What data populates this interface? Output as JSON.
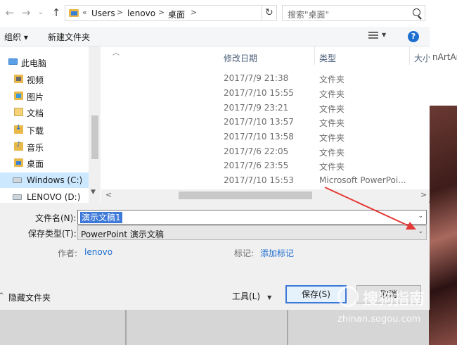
{
  "address": {
    "path_prefix": "«",
    "crumbs": [
      "Users",
      "lenovo",
      "桌面"
    ],
    "search_placeholder": "搜索\"桌面\""
  },
  "toolbar": {
    "organize": "组织 ▾",
    "new_folder": "新建文件夹"
  },
  "nav": {
    "items": [
      {
        "label": "此电脑",
        "icon": "pc-icon"
      },
      {
        "label": "视频",
        "icon": "video-folder-icon"
      },
      {
        "label": "图片",
        "icon": "picture-folder-icon"
      },
      {
        "label": "文档",
        "icon": "document-folder-icon"
      },
      {
        "label": "下载",
        "icon": "download-folder-icon"
      },
      {
        "label": "音乐",
        "icon": "music-folder-icon"
      },
      {
        "label": "桌面",
        "icon": "desktop-folder-icon"
      },
      {
        "label": "Windows (C:)",
        "icon": "drive-icon"
      },
      {
        "label": "LENOVO (D:)",
        "icon": "drive-icon"
      }
    ]
  },
  "files": {
    "columns": {
      "date": "修改日期",
      "type": "类型",
      "size": "大小"
    },
    "rows": [
      {
        "date": "2017/7/9 21:38",
        "type": "文件夹"
      },
      {
        "date": "2017/7/10 15:55",
        "type": "文件夹"
      },
      {
        "date": "2017/7/9 23:21",
        "type": "文件夹"
      },
      {
        "date": "2017/7/10 13:57",
        "type": "文件夹"
      },
      {
        "date": "2017/7/10 13:58",
        "type": "文件夹"
      },
      {
        "date": "2017/7/6 22:05",
        "type": "文件夹"
      },
      {
        "date": "2017/7/6 23:55",
        "type": "文件夹"
      },
      {
        "date": "2017/7/10 15:53",
        "type": "Microsoft PowerPoi..."
      }
    ]
  },
  "save": {
    "filename_label": "文件名(N):",
    "filename_value": "演示文稿1",
    "filetype_label": "保存类型(T):",
    "filetype_value": "PowerPoint 演示文稿",
    "author_label": "作者:",
    "author_value": "lenovo",
    "tags_label": "标记:",
    "tags_value": "添加标记",
    "hide_folders": "隐藏文件夹",
    "tools": "工具(L)",
    "save_button": "保存(S)",
    "cancel_button": "取消"
  },
  "background": {
    "artwork_text": "nArtArt",
    "watermark_main": "搜狗指南",
    "watermark_url": "zhinan.sogou.com"
  },
  "colors": {
    "accent": "#1f6fd1",
    "selection": "#cce8ff",
    "annotation_arrow": "#e53935"
  }
}
